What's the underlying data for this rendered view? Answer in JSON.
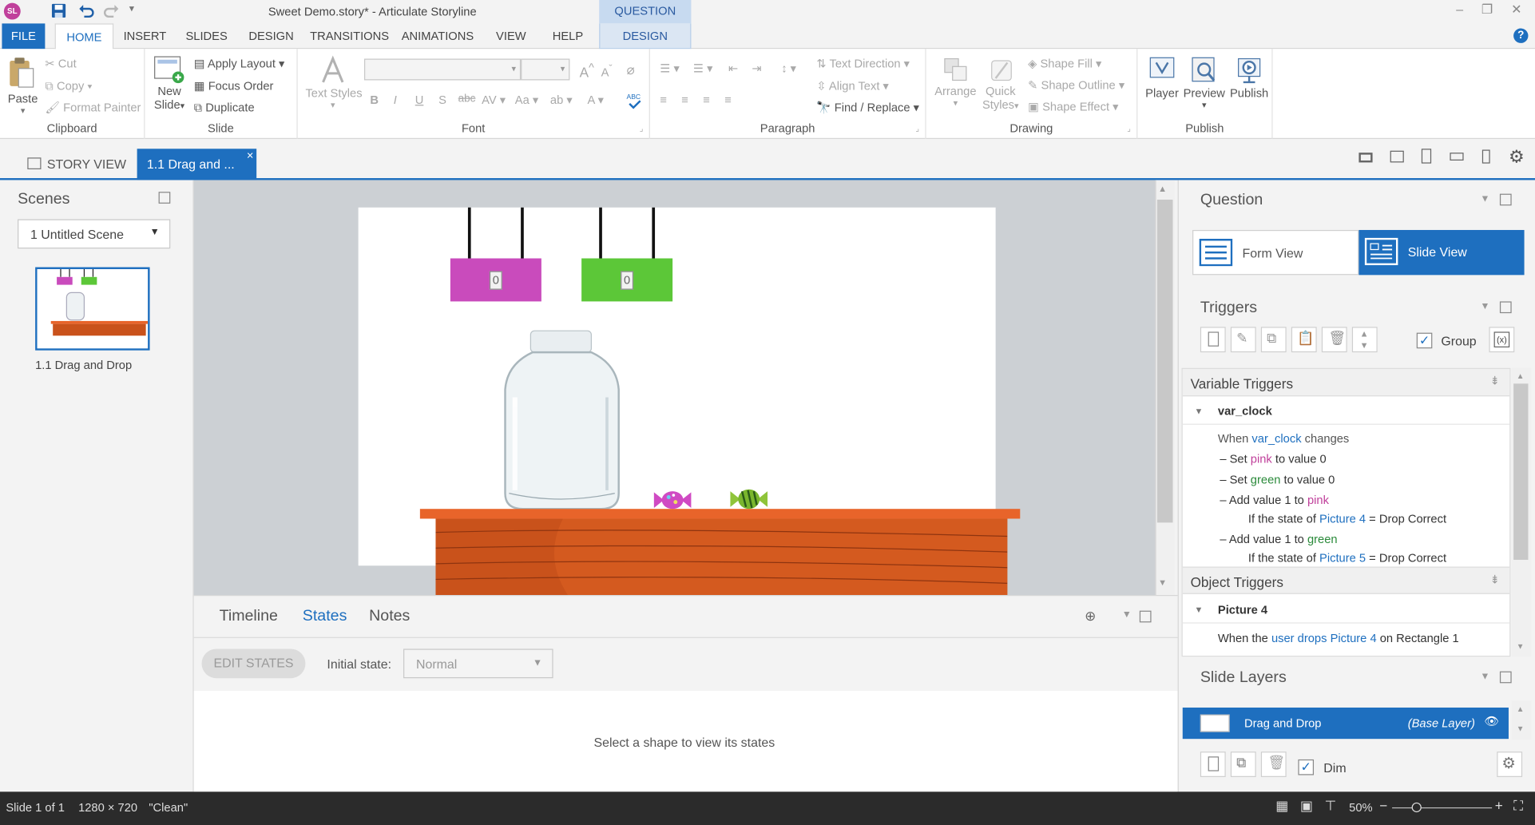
{
  "app": {
    "title": "Sweet Demo.story* - Articulate Storyline",
    "logo": "SL",
    "question_tools": "QUESTION TOOLS"
  },
  "tabs": [
    "FILE",
    "HOME",
    "INSERT",
    "SLIDES",
    "DESIGN",
    "TRANSITIONS",
    "ANIMATIONS",
    "VIEW",
    "HELP",
    "DESIGN"
  ],
  "ribbon": {
    "clipboard": {
      "paste": "Paste",
      "cut": "Cut",
      "copy": "Copy",
      "format_painter": "Format Painter",
      "label": "Clipboard"
    },
    "slide": {
      "new_slide_1": "New",
      "new_slide_2": "Slide",
      "apply_layout": "Apply Layout",
      "focus_order": "Focus Order",
      "duplicate": "Duplicate",
      "label": "Slide"
    },
    "font": {
      "text_styles": "Text Styles",
      "label": "Font",
      "bold": "B",
      "italic": "I",
      "underline": "U",
      "shadow": "S",
      "strike": "abc",
      "spacing": "AV",
      "case": "Aa",
      "grow": "A",
      "shrink": "A"
    },
    "paragraph": {
      "text_direction": "Text Direction",
      "align_text": "Align Text",
      "find_replace": "Find / Replace",
      "label": "Paragraph"
    },
    "drawing": {
      "arrange": "Arrange",
      "quick_styles_1": "Quick",
      "quick_styles_2": "Styles",
      "shape_fill": "Shape Fill",
      "shape_outline": "Shape Outline",
      "shape_effect": "Shape Effect",
      "label": "Drawing"
    },
    "publish": {
      "player": "Player",
      "preview": "Preview",
      "publish": "Publish",
      "label": "Publish"
    }
  },
  "view_tabs": {
    "story_view": "STORY VIEW",
    "slide_tab": "1.1 Drag and ...",
    "close": "×"
  },
  "scenes": {
    "title": "Scenes",
    "selected_scene": "1 Untitled Scene",
    "thumb_label": "1.1 Drag and Drop"
  },
  "stage": {
    "pink_counter": "0",
    "green_counter": "0"
  },
  "bottom": {
    "tabs": [
      "Timeline",
      "States",
      "Notes"
    ],
    "edit_states": "EDIT STATES",
    "initial_state_label": "Initial state:",
    "initial_state_value": "Normal",
    "empty_msg": "Select a shape to view its states"
  },
  "question": {
    "title": "Question",
    "form_view": "Form View",
    "slide_view": "Slide View"
  },
  "triggers": {
    "title": "Triggers",
    "group": "Group",
    "variable_triggers": "Variable Triggers",
    "var_name": "var_clock",
    "lines": {
      "l1a": "When",
      "l1b": "var_clock",
      "l1c": "changes",
      "l2a": "Set",
      "l2b": "pink",
      "l2c": "to value 0",
      "l3a": "Set",
      "l3b": "green",
      "l3c": "to value 0",
      "l4a": "Add value 1 to",
      "l4b": "pink",
      "l5a": "If the state of",
      "l5b": "Picture 4",
      "l5c": "= Drop Correct",
      "l6a": "Add value 1 to",
      "l6b": "green",
      "l7a": "If the state of",
      "l7b": "Picture 5",
      "l7c": "= Drop Correct"
    },
    "object_triggers": "Object Triggers",
    "object_name": "Picture 4",
    "obj_line": {
      "a": "When the",
      "b": "user drops",
      "c": "Picture 4",
      "d": "on Rectangle 1"
    }
  },
  "layers": {
    "title": "Slide Layers",
    "layer_name": "Drag and Drop",
    "base": "(Base Layer)",
    "dim": "Dim"
  },
  "status": {
    "slide": "Slide 1 of 1",
    "size": "1280 × 720",
    "theme": "\"Clean\"",
    "zoom": "50%",
    "minus": "−",
    "plus": "+"
  },
  "colors": {
    "accent": "#1e6fbf",
    "pink": "#c94bbc",
    "green": "#5cc738",
    "wood": "#d95a1f"
  }
}
